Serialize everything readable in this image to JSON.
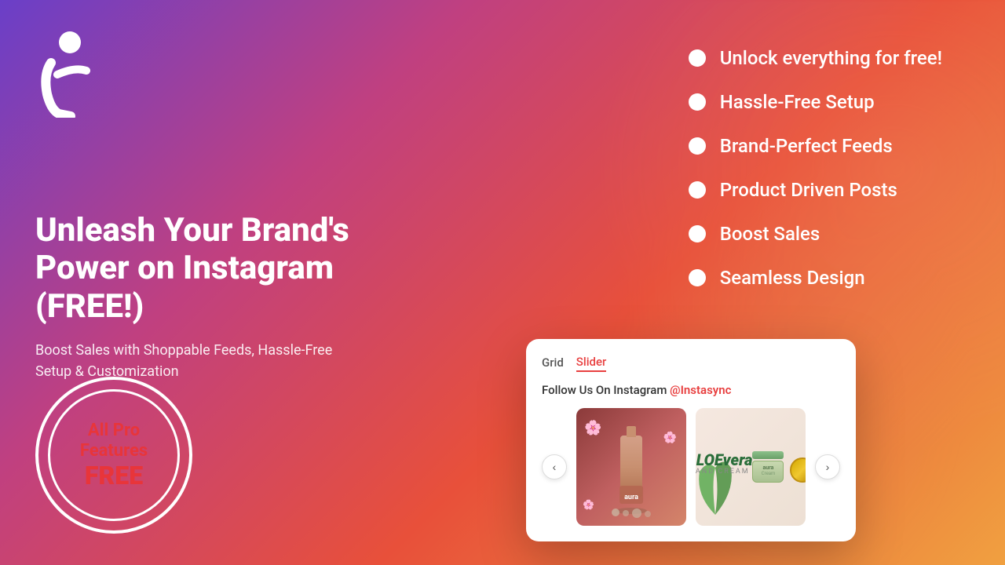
{
  "logo": {
    "alt": "Instasync logo"
  },
  "heading": {
    "main": "Unleash Your Brand's Power on Instagram (FREE!)",
    "sub": "Boost Sales with Shoppable Feeds, Hassle-Free Setup & Customization"
  },
  "badge": {
    "line1": "All Pro",
    "line2": "Features",
    "line3": "FREE"
  },
  "features": [
    {
      "label": "Unlock everything for free!"
    },
    {
      "label": "Hassle-Free Setup"
    },
    {
      "label": "Brand-Perfect Feeds"
    },
    {
      "label": "Product Driven Posts"
    },
    {
      "label": "Boost Sales"
    },
    {
      "label": "Seamless Design"
    }
  ],
  "widget": {
    "tab_grid": "Grid",
    "tab_slider": "Slider",
    "header_text": "Follow Us On Instagram",
    "handle": "@Instasync",
    "nav_prev": "‹",
    "nav_next": "›",
    "product1_alt": "Perfume bottle product",
    "product2_brand": "ALOEvera",
    "product2_type": "HAND CREAM"
  }
}
